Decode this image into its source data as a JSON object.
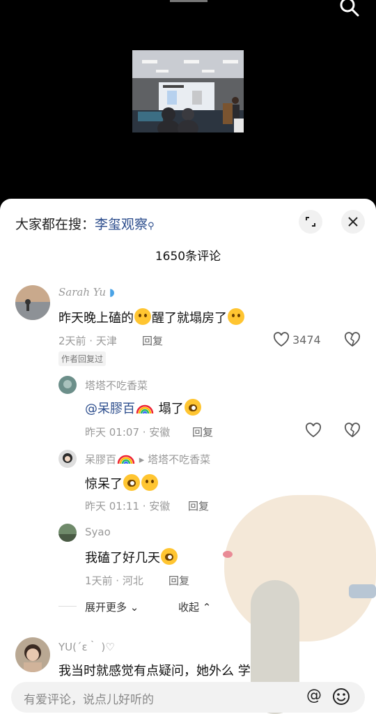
{
  "hot_search": {
    "prefix": "大家都在搜：",
    "keyword": "李玺观察"
  },
  "comment_count": "1650条评论",
  "comments": [
    {
      "user": "Sarah Yu",
      "text_a": "昨天晚上磕的",
      "text_b": "醒了就塌房了",
      "meta": "2天前 · 天津",
      "reply": "回复",
      "tag": "作者回复过",
      "likes": "3474"
    },
    {
      "user": "塔塔不吃香菜",
      "mention": "@呆膠百",
      "text": "塌了",
      "meta": "昨天 01:07 · 安徽",
      "reply": "回复"
    },
    {
      "user": "呆膠百",
      "reply_to": "塔塔不吃香菜",
      "text": "惊呆了",
      "meta": "昨天 01:11 · 安徽",
      "reply": "回复"
    },
    {
      "user": "Syao",
      "text": "我磕了好几天",
      "meta": "1天前 · 河北",
      "reply": "回复"
    },
    {
      "user": "YU(´ε｀ )♡",
      "text": "我当时就感觉有点疑问，她外么        学大学教"
    }
  ],
  "expand_more": "展开更多",
  "collapse": "收起",
  "input": {
    "placeholder": "有爱评论，说点儿好听的"
  },
  "icons": [
    "search-icon",
    "expand-icon",
    "close-icon",
    "heart-icon",
    "dislike-icon",
    "at-icon",
    "emoji-icon"
  ]
}
